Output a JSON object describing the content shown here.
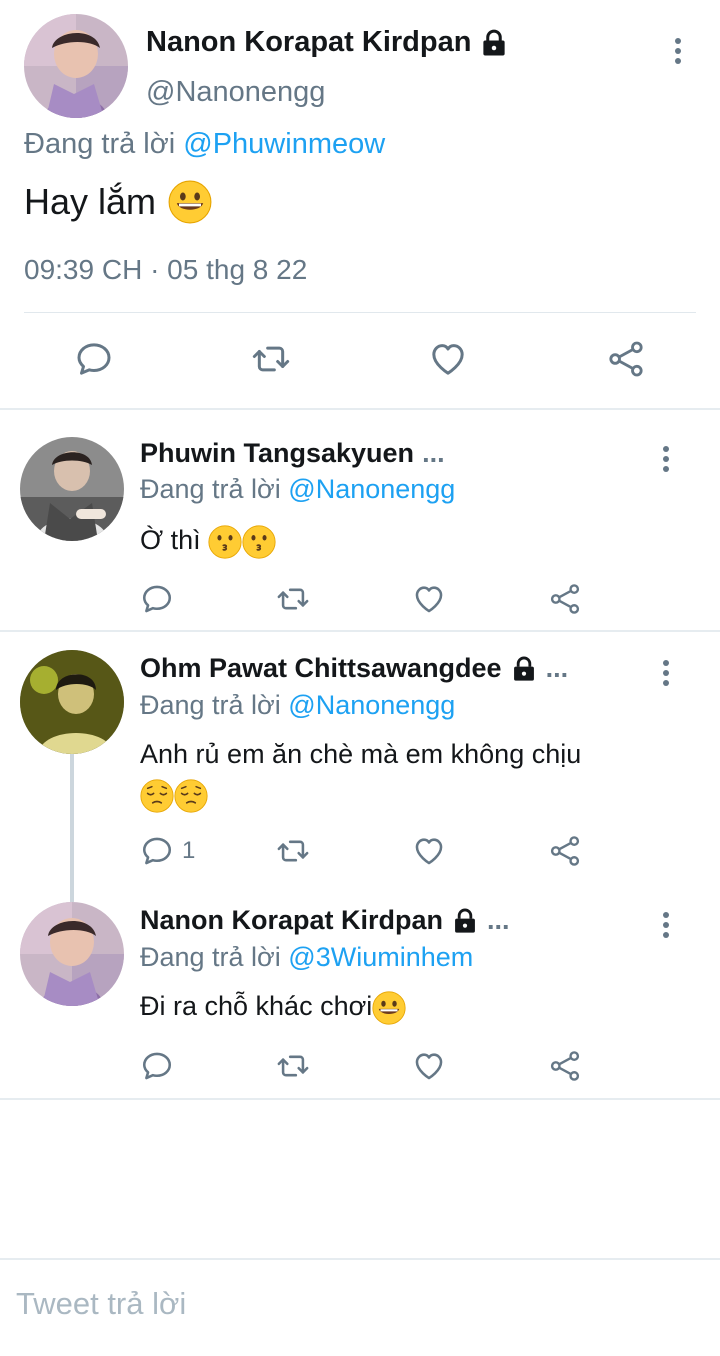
{
  "main_tweet": {
    "author_name": "Nanon Korapat Kirdpan",
    "handle": "@Nanonengg",
    "replying_prefix": "Đang trả lời",
    "replying_to": "@Phuwinmeow",
    "text": "Hay lắm",
    "emoji": "grinning-face",
    "timestamp": "09:39 CH · 05 thg 8 22"
  },
  "replies": [
    {
      "author_name": "Phuwin Tangsakyuen",
      "ellipsis": "...",
      "replying_prefix": "Đang trả lời",
      "replying_to": "@Nanonengg",
      "text": "Ờ thì",
      "emoji": [
        "kissing-face",
        "kissing-face"
      ],
      "reply_count": ""
    },
    {
      "author_name": "Ohm Pawat Chittsawangdee",
      "ellipsis": "...",
      "replying_prefix": "Đang trả lời",
      "replying_to": "@Nanonengg",
      "text": "Anh rủ em ăn chè mà em không chịu",
      "emoji": [
        "pensive-face",
        "pensive-face"
      ],
      "reply_count": "1"
    },
    {
      "author_name": "Nanon Korapat Kirdpan",
      "ellipsis": "...",
      "replying_prefix": "Đang trả lời",
      "replying_to": "@3Wiuminhem",
      "text": "Đi ra chỗ khác chơi",
      "emoji": [
        "grinning-face"
      ],
      "reply_count": ""
    }
  ],
  "composer": {
    "placeholder": "Tweet trả lời"
  },
  "colors": {
    "link": "#1da1f2",
    "muted": "#657786",
    "divider": "#e6ecf0",
    "text": "#14171a"
  }
}
